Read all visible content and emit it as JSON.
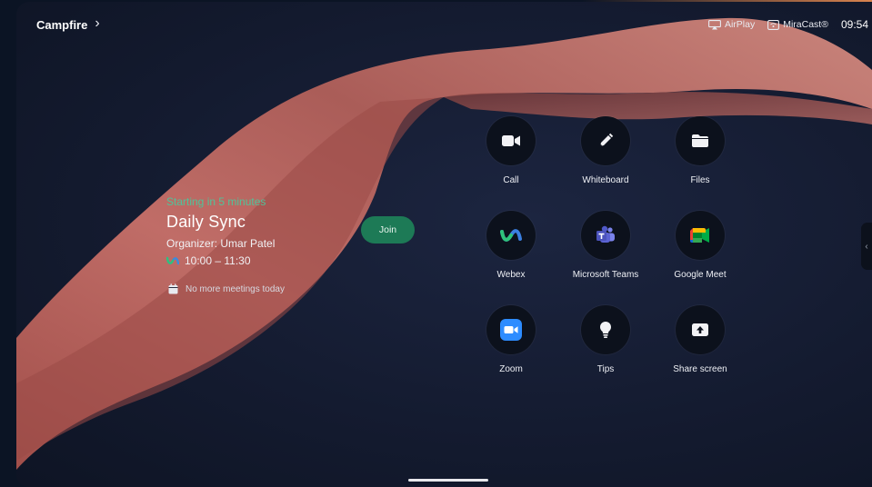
{
  "header": {
    "room_name": "Campfire",
    "room_chevron": "›",
    "airplay_label": "AirPlay",
    "miracast_label": "MiraCast®",
    "clock": "09:54"
  },
  "meeting": {
    "starting_text": "Starting in 5 minutes",
    "title": "Daily Sync",
    "organizer": "Organizer: Umar Patel",
    "time": "10:00 – 11:30",
    "join_label": "Join",
    "no_more_text": "No more meetings today"
  },
  "apps": [
    {
      "label": "Call",
      "icon": "video-camera-icon"
    },
    {
      "label": "Whiteboard",
      "icon": "pen-icon"
    },
    {
      "label": "Files",
      "icon": "folder-icon"
    },
    {
      "label": "Webex",
      "icon": "webex-icon"
    },
    {
      "label": "Microsoft Teams",
      "icon": "teams-icon"
    },
    {
      "label": "Google Meet",
      "icon": "google-meet-icon"
    },
    {
      "label": "Zoom",
      "icon": "zoom-icon"
    },
    {
      "label": "Tips",
      "icon": "lightbulb-icon"
    },
    {
      "label": "Share screen",
      "icon": "share-screen-icon"
    }
  ],
  "side_handle_glyph": "‹",
  "colors": {
    "accent_green": "#4fc49a",
    "join_button": "#1d7a56",
    "ribbon": "#c9716a"
  }
}
